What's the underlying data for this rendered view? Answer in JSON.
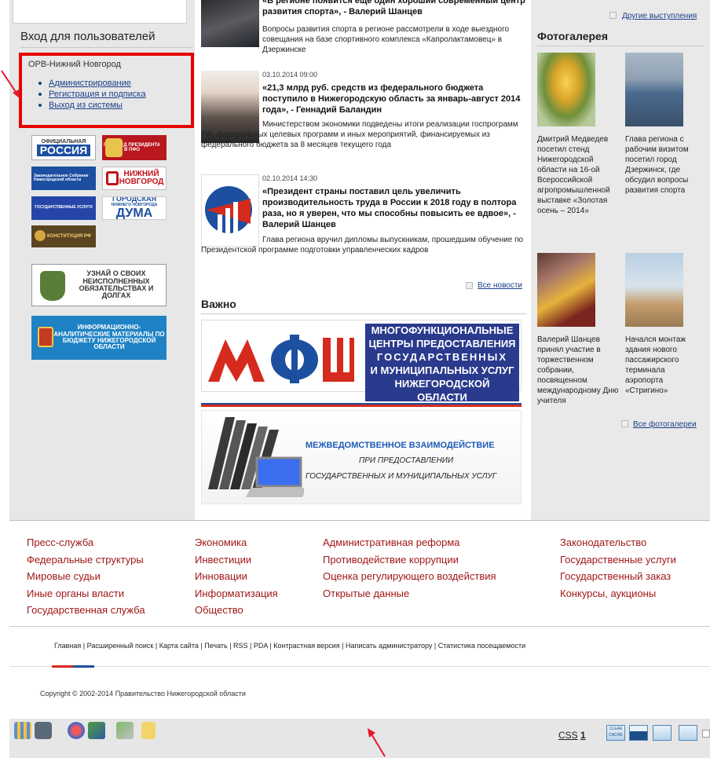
{
  "login": {
    "heading": "Вход для пользователей",
    "org": "ОРВ-Нижний Новгород",
    "links": [
      "Администрирование",
      "Регистрация и подписка",
      "Выход из системы"
    ]
  },
  "banners": {
    "russia_top": "ОФИЦИАЛЬНАЯ",
    "russia": "РОССИЯ",
    "president": "ПОЛПРЕД ПРЕЗИДЕНТА В ПФО",
    "zs": "Законодательное Собрание Нижегородской области",
    "nn_top": "НИЖНИЙ",
    "nn_bottom": "НОВГОРОД",
    "gos": "ГОСУДАРСТВЕННЫЕ УСЛУГИ",
    "duma_small": "НИЖНЕГО НОВГОРОДА",
    "duma_top": "ГОРОДСКАЯ",
    "duma_big": "ДУМА",
    "const": "КОНСТИТУЦИЯ РФ",
    "fssp": "УЗНАЙ О СВОИХ НЕИСПОЛНЕННЫХ ОБЯЗАТЕЛЬСТВАХ И ДОЛГАХ",
    "budget": "ИНФОРМАЦИОННО-АНАЛИТИЧЕСКИЕ МАТЕРИАЛЫ ПО БЮДЖЕТУ НИЖЕГОРОДСКОЙ ОБЛАСТИ"
  },
  "news": [
    {
      "date": "",
      "title": "«В регионе появится еще один хороший современный центр развития спорта», - Валерий Шанцев",
      "text": "Вопросы развития спорта в регионе рассмотрели в ходе выездного совещания на базе спортивного комплекса «Капролактамовец» в Дзержинске"
    },
    {
      "date": "03.10.2014 09:00",
      "title": "«21,3 млрд руб. средств из федерального бюджета поступило в Нижегородскую область за январь-август 2014 года», - Геннадий Баландин",
      "text": "Министерством экономики подведены итоги реализации госпрограмм РФ, федеральных целевых программ и иных мероприятий, финансируемых из федерального бюджета за 8 месяцев текущего года"
    },
    {
      "date": "02.10.2014 14:30",
      "title": "«Президент страны поставил цель увеличить производительность труда в России к 2018 году в полтора раза, но я уверен, что мы способны повысить ее вдвое», - Валерий Шанцев",
      "text": "Глава региона вручил дипломы выпускникам, прошедшим обучение по Президентской программе подготовки управленческих кадров"
    }
  ],
  "all_news": "Все новости",
  "important": "Важно",
  "mfc": {
    "logo": "МФЦ",
    "lines": [
      "МНОГОФУНКЦИОНАЛЬНЫЕ",
      "ЦЕНТРЫ ПРЕДОСТАВЛЕНИЯ",
      "ГОСУДАРСТВЕННЫХ",
      "И МУНИЦИПАЛЬНЫХ УСЛУГ",
      "НИЖЕГОРОДСКОЙ ОБЛАСТИ"
    ]
  },
  "mvv": {
    "line1": "МЕЖВЕДОМСТВЕННОЕ ВЗАИМОДЕЙСТВИЕ",
    "line2": "ПРИ ПРЕДОСТАВЛЕНИИ",
    "line3": "ГОСУДАРСТВЕННЫХ И МУНИЦИПАЛЬНЫХ УСЛУГ"
  },
  "right": {
    "other": "Другие выступления",
    "gallery_heading": "Фотогалерея",
    "captions": [
      "Дмитрий Медведев посетил стенд Нижегородской области на 16-ой Всероссийской агропромышленной выставке «Золотая осень – 2014»",
      "Глава региона с рабочим визитом посетил город Дзержинск, где обсудил вопросы развития спорта",
      "Валерий Шанцев принял участие в торжественном собрании, посвященном международному Дню учителя",
      "Начался монтаж здания нового пассажирского терминала аэропорта «Стригино»"
    ],
    "all_photos": "Все фотогалереи"
  },
  "footer_links": {
    "col1": [
      "Пресс-служба",
      "Федеральные структуры",
      "Мировые судьи",
      "Иные органы власти",
      "Государственная служба"
    ],
    "col2": [
      "Экономика",
      "Инвестиции",
      "Инновации",
      "Информатизация",
      "Общество"
    ],
    "col3": [
      "Административная реформа",
      "Противодействие коррупции",
      "Оценка регулирующего воздействия",
      "Открытые данные"
    ],
    "col4": [
      "Законодательство",
      "Государственные услуги",
      "Государственный заказ",
      "Конкурсы, аукционы"
    ]
  },
  "bottom_nav": [
    "Главная",
    "Расширенный поиск",
    "Карта сайта",
    "Печать",
    "RSS",
    "PDA",
    "Контрастная версия",
    "Написать администратору",
    "Статистика посещаемости"
  ],
  "copyright": "Copyright © 2002-2014 Правительство Нижегородской области",
  "toolbar": {
    "css_label": "CSS",
    "css_num": "1",
    "clear_cache": "CLEAR CACHE"
  },
  "colors": {
    "footer_link": "#a01818",
    "link": "#1a3f8a",
    "highlight_box": "#e60000",
    "annotation_arrow": "#e3182d"
  }
}
